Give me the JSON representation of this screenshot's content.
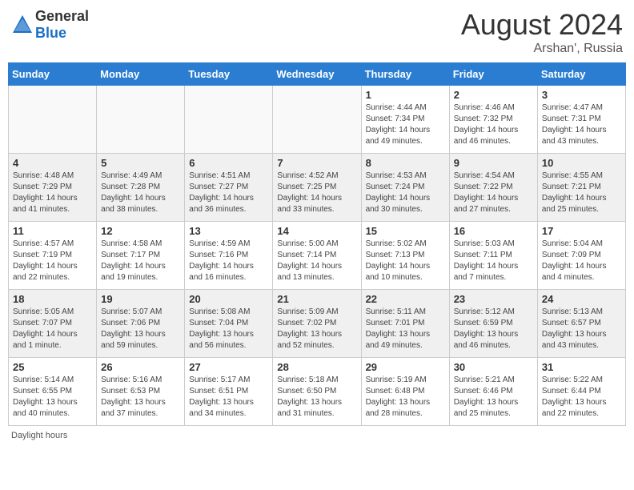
{
  "header": {
    "logo_general": "General",
    "logo_blue": "Blue",
    "month_year": "August 2024",
    "location": "Arshan', Russia"
  },
  "days_of_week": [
    "Sunday",
    "Monday",
    "Tuesday",
    "Wednesday",
    "Thursday",
    "Friday",
    "Saturday"
  ],
  "weeks": [
    [
      {
        "day": "",
        "info": ""
      },
      {
        "day": "",
        "info": ""
      },
      {
        "day": "",
        "info": ""
      },
      {
        "day": "",
        "info": ""
      },
      {
        "day": "1",
        "info": "Sunrise: 4:44 AM\nSunset: 7:34 PM\nDaylight: 14 hours\nand 49 minutes."
      },
      {
        "day": "2",
        "info": "Sunrise: 4:46 AM\nSunset: 7:32 PM\nDaylight: 14 hours\nand 46 minutes."
      },
      {
        "day": "3",
        "info": "Sunrise: 4:47 AM\nSunset: 7:31 PM\nDaylight: 14 hours\nand 43 minutes."
      }
    ],
    [
      {
        "day": "4",
        "info": "Sunrise: 4:48 AM\nSunset: 7:29 PM\nDaylight: 14 hours\nand 41 minutes."
      },
      {
        "day": "5",
        "info": "Sunrise: 4:49 AM\nSunset: 7:28 PM\nDaylight: 14 hours\nand 38 minutes."
      },
      {
        "day": "6",
        "info": "Sunrise: 4:51 AM\nSunset: 7:27 PM\nDaylight: 14 hours\nand 36 minutes."
      },
      {
        "day": "7",
        "info": "Sunrise: 4:52 AM\nSunset: 7:25 PM\nDaylight: 14 hours\nand 33 minutes."
      },
      {
        "day": "8",
        "info": "Sunrise: 4:53 AM\nSunset: 7:24 PM\nDaylight: 14 hours\nand 30 minutes."
      },
      {
        "day": "9",
        "info": "Sunrise: 4:54 AM\nSunset: 7:22 PM\nDaylight: 14 hours\nand 27 minutes."
      },
      {
        "day": "10",
        "info": "Sunrise: 4:55 AM\nSunset: 7:21 PM\nDaylight: 14 hours\nand 25 minutes."
      }
    ],
    [
      {
        "day": "11",
        "info": "Sunrise: 4:57 AM\nSunset: 7:19 PM\nDaylight: 14 hours\nand 22 minutes."
      },
      {
        "day": "12",
        "info": "Sunrise: 4:58 AM\nSunset: 7:17 PM\nDaylight: 14 hours\nand 19 minutes."
      },
      {
        "day": "13",
        "info": "Sunrise: 4:59 AM\nSunset: 7:16 PM\nDaylight: 14 hours\nand 16 minutes."
      },
      {
        "day": "14",
        "info": "Sunrise: 5:00 AM\nSunset: 7:14 PM\nDaylight: 14 hours\nand 13 minutes."
      },
      {
        "day": "15",
        "info": "Sunrise: 5:02 AM\nSunset: 7:13 PM\nDaylight: 14 hours\nand 10 minutes."
      },
      {
        "day": "16",
        "info": "Sunrise: 5:03 AM\nSunset: 7:11 PM\nDaylight: 14 hours\nand 7 minutes."
      },
      {
        "day": "17",
        "info": "Sunrise: 5:04 AM\nSunset: 7:09 PM\nDaylight: 14 hours\nand 4 minutes."
      }
    ],
    [
      {
        "day": "18",
        "info": "Sunrise: 5:05 AM\nSunset: 7:07 PM\nDaylight: 14 hours\nand 1 minute."
      },
      {
        "day": "19",
        "info": "Sunrise: 5:07 AM\nSunset: 7:06 PM\nDaylight: 13 hours\nand 59 minutes."
      },
      {
        "day": "20",
        "info": "Sunrise: 5:08 AM\nSunset: 7:04 PM\nDaylight: 13 hours\nand 56 minutes."
      },
      {
        "day": "21",
        "info": "Sunrise: 5:09 AM\nSunset: 7:02 PM\nDaylight: 13 hours\nand 52 minutes."
      },
      {
        "day": "22",
        "info": "Sunrise: 5:11 AM\nSunset: 7:01 PM\nDaylight: 13 hours\nand 49 minutes."
      },
      {
        "day": "23",
        "info": "Sunrise: 5:12 AM\nSunset: 6:59 PM\nDaylight: 13 hours\nand 46 minutes."
      },
      {
        "day": "24",
        "info": "Sunrise: 5:13 AM\nSunset: 6:57 PM\nDaylight: 13 hours\nand 43 minutes."
      }
    ],
    [
      {
        "day": "25",
        "info": "Sunrise: 5:14 AM\nSunset: 6:55 PM\nDaylight: 13 hours\nand 40 minutes."
      },
      {
        "day": "26",
        "info": "Sunrise: 5:16 AM\nSunset: 6:53 PM\nDaylight: 13 hours\nand 37 minutes."
      },
      {
        "day": "27",
        "info": "Sunrise: 5:17 AM\nSunset: 6:51 PM\nDaylight: 13 hours\nand 34 minutes."
      },
      {
        "day": "28",
        "info": "Sunrise: 5:18 AM\nSunset: 6:50 PM\nDaylight: 13 hours\nand 31 minutes."
      },
      {
        "day": "29",
        "info": "Sunrise: 5:19 AM\nSunset: 6:48 PM\nDaylight: 13 hours\nand 28 minutes."
      },
      {
        "day": "30",
        "info": "Sunrise: 5:21 AM\nSunset: 6:46 PM\nDaylight: 13 hours\nand 25 minutes."
      },
      {
        "day": "31",
        "info": "Sunrise: 5:22 AM\nSunset: 6:44 PM\nDaylight: 13 hours\nand 22 minutes."
      }
    ]
  ],
  "footer": {
    "label": "Daylight hours"
  }
}
